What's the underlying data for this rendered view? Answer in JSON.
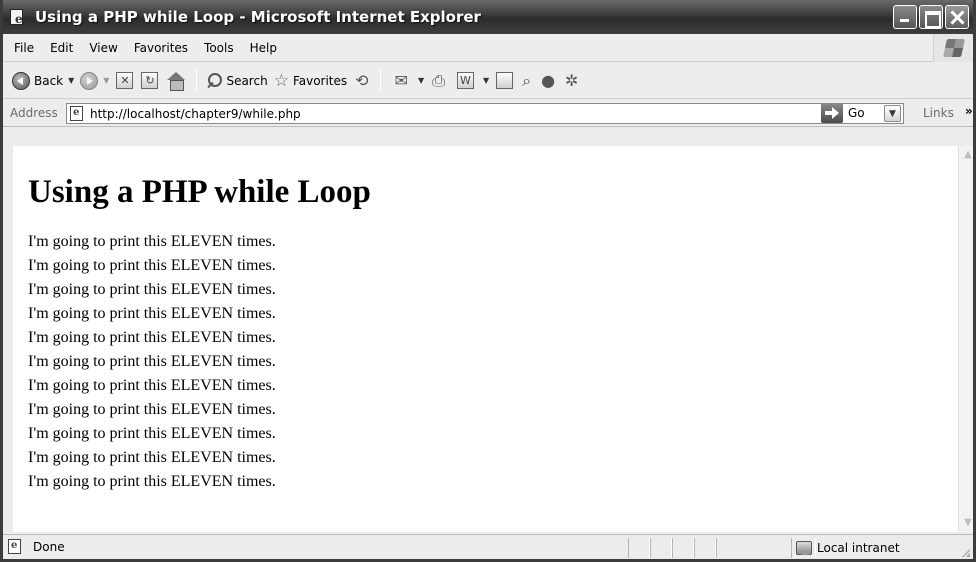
{
  "window": {
    "title": "Using a PHP while Loop - Microsoft Internet Explorer"
  },
  "menubar": {
    "items": [
      "File",
      "Edit",
      "View",
      "Favorites",
      "Tools",
      "Help"
    ]
  },
  "toolbar": {
    "back_label": "Back",
    "search_label": "Search",
    "favorites_label": "Favorites"
  },
  "addressbar": {
    "label": "Address",
    "url": "http://localhost/chapter9/while.php",
    "go_label": "Go",
    "links_label": "Links",
    "links_chevron": "»"
  },
  "page": {
    "heading": "Using a PHP while Loop",
    "lines": [
      "I'm going to print this ELEVEN times.",
      "I'm going to print this ELEVEN times.",
      "I'm going to print this ELEVEN times.",
      "I'm going to print this ELEVEN times.",
      "I'm going to print this ELEVEN times.",
      "I'm going to print this ELEVEN times.",
      "I'm going to print this ELEVEN times.",
      "I'm going to print this ELEVEN times.",
      "I'm going to print this ELEVEN times.",
      "I'm going to print this ELEVEN times.",
      "I'm going to print this ELEVEN times."
    ]
  },
  "statusbar": {
    "status": "Done",
    "zone": "Local intranet"
  },
  "icons": {
    "title": "ie-page-icon",
    "back": "back-arrow-icon",
    "forward": "forward-arrow-icon",
    "stop": "stop-icon",
    "refresh": "refresh-icon",
    "home": "home-icon",
    "search": "search-icon",
    "favorites": "star-icon",
    "history": "history-icon",
    "mail": "mail-icon",
    "print": "print-icon",
    "edit": "word-edit-icon",
    "discuss": "discuss-icon",
    "research": "research-icon",
    "messenger": "messenger-icon",
    "zone": "intranet-icon"
  }
}
